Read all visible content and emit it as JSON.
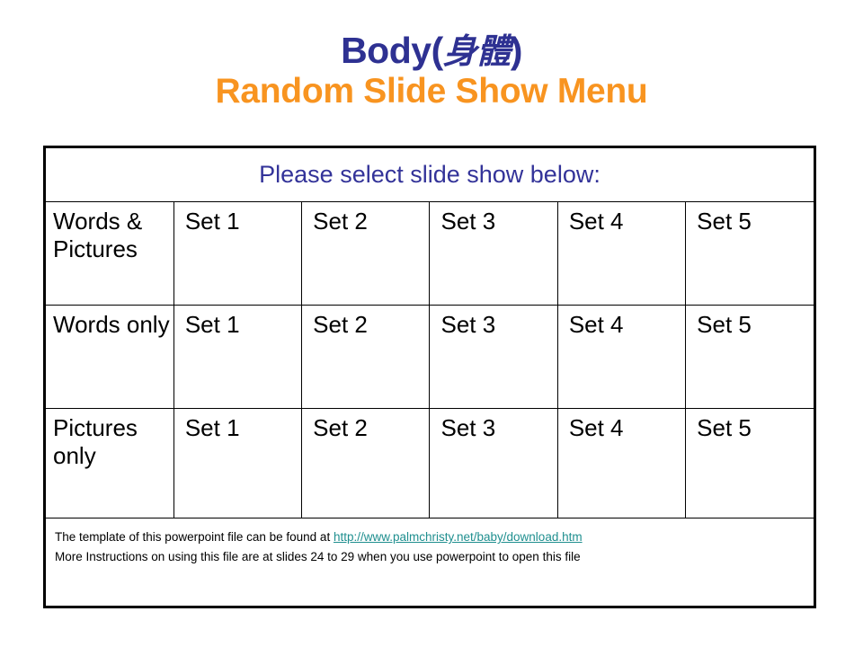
{
  "slide": {
    "title_main_prefix": "Body(",
    "title_main_cjk": "身體",
    "title_main_suffix": ")",
    "title_sub": "Random Slide Show Menu",
    "colors": {
      "title_blue": "#2E3192",
      "title_orange": "#F89420",
      "prompt_blue": "#333399",
      "link_teal": "#1F8F8F",
      "border_black": "#000000",
      "background": "#FFFFFF"
    }
  },
  "menu": {
    "prompt": "Please select slide show below:",
    "rows": [
      {
        "label": "Words & Pictures",
        "sets": [
          "Set 1",
          "Set 2",
          "Set 3",
          "Set 4",
          "Set 5"
        ]
      },
      {
        "label": "Words only",
        "sets": [
          "Set 1",
          "Set 2",
          "Set 3",
          "Set 4",
          "Set 5"
        ]
      },
      {
        "label": "Pictures only",
        "sets": [
          "Set 1",
          "Set 2",
          "Set 3",
          "Set 4",
          "Set 5"
        ]
      }
    ]
  },
  "footer": {
    "line1_prefix": "The template of this powerpoint file can be found at ",
    "line1_link": "http://www.palmchristy.net/baby/download.htm",
    "line2": "More Instructions on using this file are at slides 24 to 29 when you use powerpoint to open this file"
  }
}
